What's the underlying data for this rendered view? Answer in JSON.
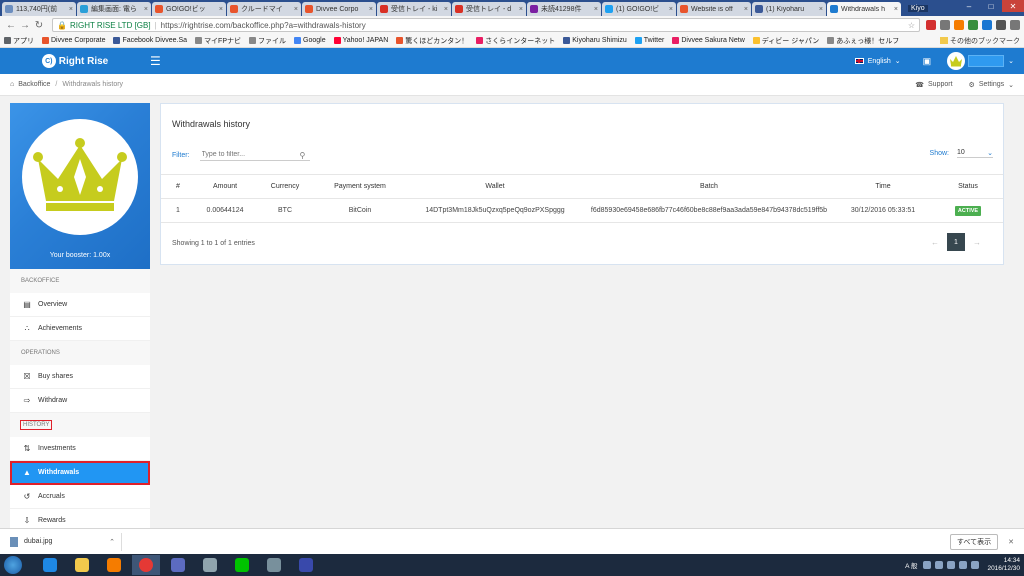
{
  "browser": {
    "tabs": [
      {
        "label": "113,740円(前",
        "color": "#6c8ebf",
        "active": false
      },
      {
        "label": "編集画面: 電ら",
        "color": "#2a9fd8",
        "active": false
      },
      {
        "label": "GO!GO!ビッ",
        "color": "#e8542c",
        "active": false
      },
      {
        "label": "クルードマイ",
        "color": "#e8542c",
        "active": false
      },
      {
        "label": "Divvee Corpo",
        "color": "#e8542c",
        "active": false
      },
      {
        "label": "受信トレイ - ki",
        "color": "#d93025",
        "active": false
      },
      {
        "label": "受信トレイ - d",
        "color": "#d93025",
        "active": false
      },
      {
        "label": "未読41298件",
        "color": "#7b1fa2",
        "active": false
      },
      {
        "label": "(1) GO!GO!ビ",
        "color": "#1da1f2",
        "active": false
      },
      {
        "label": "Website is off",
        "color": "#e8542c",
        "active": false
      },
      {
        "label": "(1) Kiyoharu",
        "color": "#3b5998",
        "active": false
      },
      {
        "label": "Withdrawals h",
        "color": "#1e7bd0",
        "active": true
      }
    ],
    "window_user": "Kiyo",
    "secure_label": "RIGHT RISE LTD [GB]",
    "url": "https://rightrise.com/backoffice.php?a=withdrawals-history",
    "bookmarks": [
      {
        "label": "アプリ",
        "color": "#5f6368"
      },
      {
        "label": "Divvee Corporate",
        "color": "#e8542c"
      },
      {
        "label": "Facebook Divvee.Sa",
        "color": "#3b5998"
      },
      {
        "label": "マイFPナビ",
        "color": "#888888"
      },
      {
        "label": "ファイル",
        "color": "#888888"
      },
      {
        "label": "Google",
        "color": "#4285f4"
      },
      {
        "label": "Yahoo! JAPAN",
        "color": "#ff0033"
      },
      {
        "label": "驚くほどカンタン！",
        "color": "#e8542c"
      },
      {
        "label": "さくらインターネット",
        "color": "#e91e63"
      },
      {
        "label": "Kiyoharu Shimizu",
        "color": "#3b5998"
      },
      {
        "label": "Twitter",
        "color": "#1da1f2"
      },
      {
        "label": "Divvee Sakura Netw",
        "color": "#e91e63"
      },
      {
        "label": "ディビー ジャパン",
        "color": "#fbc02d"
      },
      {
        "label": "あふぇっ様！セルフ",
        "color": "#888888"
      }
    ],
    "other_bookmarks": "その他のブックマーク"
  },
  "header": {
    "brand": "Right Rise",
    "language": "English"
  },
  "breadcrumb": {
    "root": "Backoffice",
    "current": "Withdrawals history",
    "support": "Support",
    "settings": "Settings"
  },
  "sidebar": {
    "booster": "Your booster: 1.00x",
    "sections": {
      "backoffice": "BACKOFFICE",
      "operations": "OPERATIONS",
      "history": "HISTORY"
    },
    "items": {
      "overview": "Overview",
      "achievements": "Achievements",
      "buy_shares": "Buy shares",
      "withdraw": "Withdraw",
      "investments": "Investments",
      "withdrawals": "Withdrawals",
      "accruals": "Accruals",
      "rewards": "Rewards"
    }
  },
  "panel": {
    "title": "Withdrawals history",
    "filter_label": "Filter:",
    "filter_placeholder": "Type to filter...",
    "show_label": "Show:",
    "show_value": "10",
    "columns": [
      "#",
      "Amount",
      "Currency",
      "Payment system",
      "Wallet",
      "Batch",
      "Time",
      "Status"
    ],
    "rows": [
      {
        "num": "1",
        "amount": "0.00644124",
        "currency": "BTC",
        "payment_system": "BitCoin",
        "wallet": "14DTpt3Mm18Jk5uQzxq5peQq9ozPXSpggg",
        "batch": "f6d85930e69458e686fb77c46f60be8c88ef9aa3ada59e847b94378dc519ff5b",
        "time": "30/12/2016 05:33:51",
        "status": "ACTIVE"
      }
    ],
    "showing": "Showing 1 to 1 of 1 entries",
    "page": "1"
  },
  "downloads": {
    "file": "dubai.jpg",
    "show_all": "すべて表示"
  },
  "taskbar": {
    "time": "14:34",
    "date": "2016/12/30",
    "ime": "A 般"
  }
}
